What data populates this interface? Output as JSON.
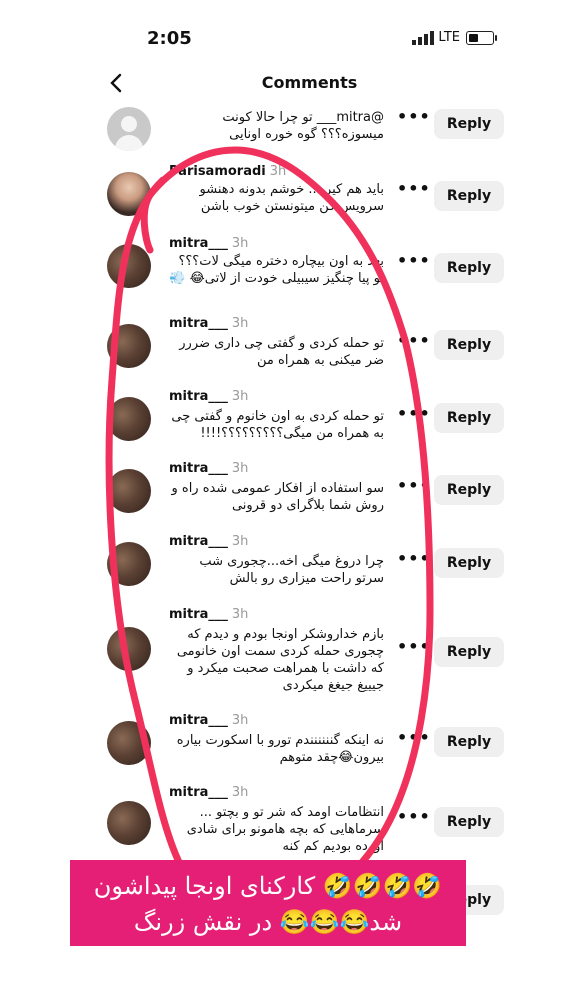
{
  "status_bar": {
    "time": "2:05",
    "network": "LTE"
  },
  "header": {
    "title": "Comments"
  },
  "comments": [
    {
      "username": "",
      "time_ago": "",
      "text": "@mitra___ تو چرا حالا کونت میسوزه؟؟؟ گوه خوره اونایی",
      "reply": "Reply"
    },
    {
      "username": "Parisamoradi",
      "time_ago": "3h",
      "text": "باید هم کیر ... خوشم بدونه دهنشو سرویس کن میتونستن خوب باشن",
      "reply": "Reply"
    },
    {
      "username": "mitra___",
      "time_ago": "3h",
      "text": "بعد به اون بیچاره دختره میگی لات؟؟؟ تو پیا چنگیز سیبیلی خودت از لاتی😂 💨",
      "reply": "Reply"
    },
    {
      "username": "mitra___",
      "time_ago": "3h",
      "text": "تو حمله کردی و گفتی چی داری ضررر ضر میکنی به همراه من",
      "reply": "Reply"
    },
    {
      "username": "mitra___",
      "time_ago": "3h",
      "text": "تو حمله کردی به اون خانوم و گفتی چی به همراه من میگی؟؟؟؟؟؟؟؟؟!!!!",
      "reply": "Reply"
    },
    {
      "username": "mitra___",
      "time_ago": "3h",
      "text": "سو استفاده از افکار عمومی شده راه و روش شما بلاگرای دو قرونی",
      "reply": "Reply"
    },
    {
      "username": "mitra___",
      "time_ago": "3h",
      "text": "چرا دروغ میگی اخه...چجوری شب سرتو راحت میزاری رو بالش",
      "reply": "Reply"
    },
    {
      "username": "mitra___",
      "time_ago": "3h",
      "text": "بازم خداروشکر اونجا بودم و دیدم که چجوری حمله کردی سمت اون خانومی که داشت با همراهت صحبت میکرد و جیییغ جیغغ میکردی",
      "reply": "Reply"
    },
    {
      "username": "mitra___",
      "time_ago": "3h",
      "text": "نه اینکه گنننننندم تورو با اسکورت بیاره بیرون😂چقد متوهم",
      "reply": "Reply"
    },
    {
      "username": "mitra___",
      "time_ago": "3h",
      "text": "انتظامات اومد که شر تو و بچتو ... سرماهایی که بچه هامونو برای شادی اورده بودیم کم کنه",
      "reply": "Reply"
    },
    {
      "username": "",
      "time_ago": "",
      "text": "",
      "reply": "Reply"
    }
  ],
  "overlay": {
    "line1": "🤣🤣🤣🤣 کارکنای اونجا پیداشون",
    "line2": "شد😂😂😂 در نقش زرنگ"
  },
  "colors": {
    "scribble": "#f0315c",
    "banner": "#e41f75"
  }
}
